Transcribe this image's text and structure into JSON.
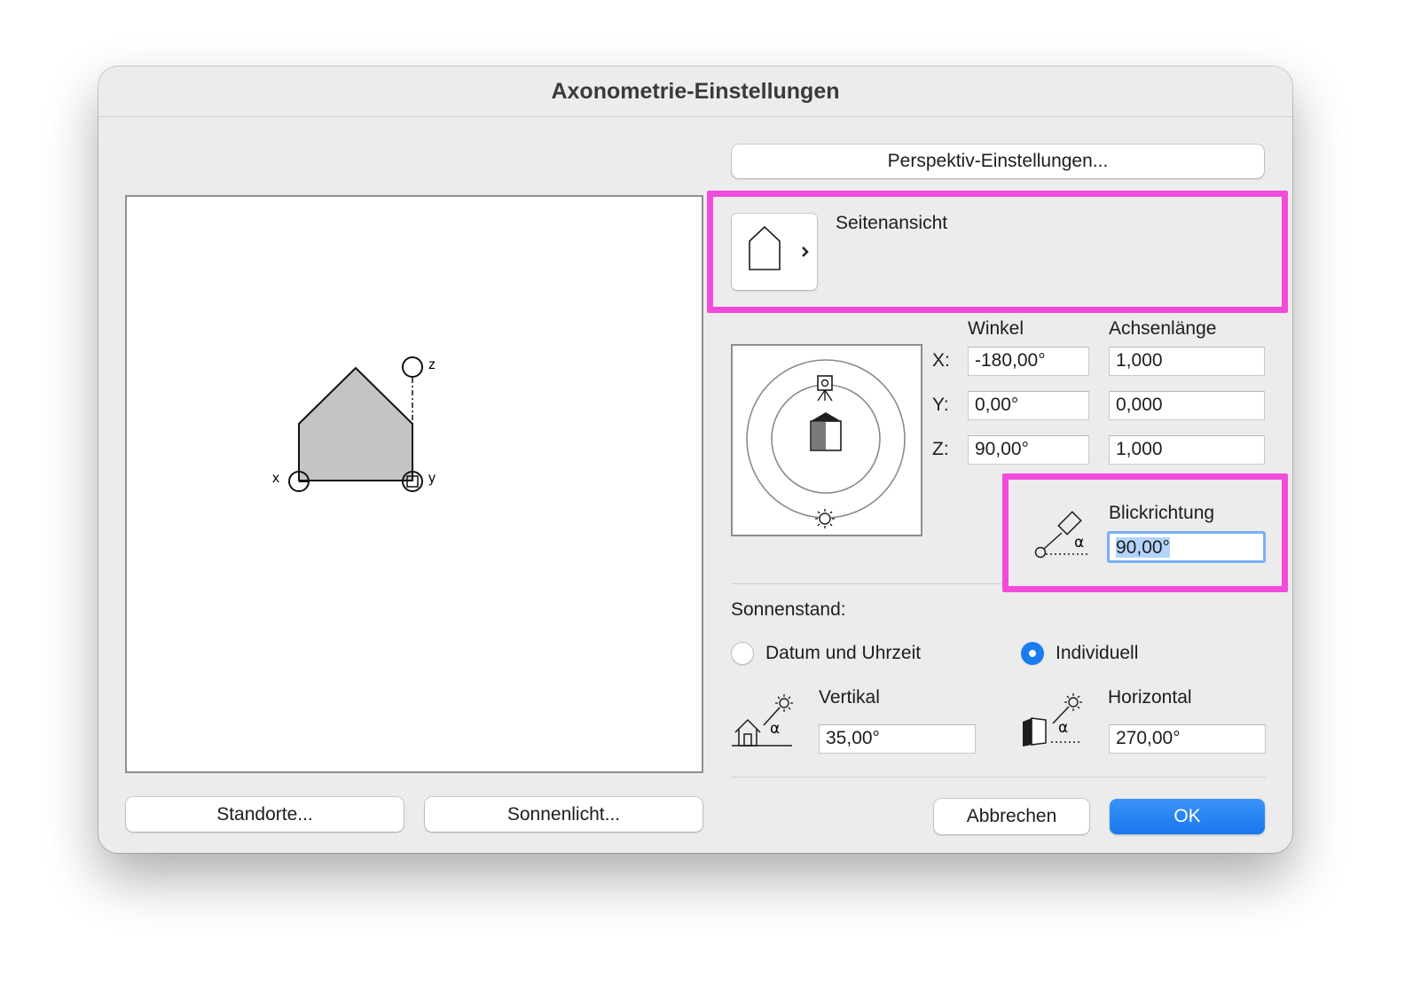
{
  "window": {
    "title": "Axonometrie-Einstellungen"
  },
  "buttons": {
    "perspective": "Perspektiv-Einstellungen...",
    "locations": "Standorte...",
    "sunlight": "Sonnenlicht...",
    "cancel": "Abbrechen",
    "ok": "OK"
  },
  "preview": {
    "axis_x": "x",
    "axis_y": "y",
    "axis_z": "z"
  },
  "view": {
    "name": "Seitenansicht"
  },
  "table": {
    "col_angle": "Winkel",
    "col_axis_length": "Achsenlänge",
    "rows": [
      {
        "label": "X:",
        "angle": "-180,00°",
        "length": "1,000"
      },
      {
        "label": "Y:",
        "angle": "0,00°",
        "length": "0,000"
      },
      {
        "label": "Z:",
        "angle": "90,00°",
        "length": "1,000"
      }
    ]
  },
  "view_direction": {
    "label": "Blickrichtung",
    "value": "90,00°"
  },
  "sun": {
    "heading": "Sonnenstand:",
    "option_date": "Datum und Uhrzeit",
    "option_custom": "Individuell",
    "selected": "Individuell",
    "vertical_label": "Vertikal",
    "vertical_value": "35,00°",
    "horizontal_label": "Horizontal",
    "horizontal_value": "270,00°"
  },
  "colors": {
    "accent": "#1a7cf0",
    "highlight": "#f14bdc",
    "house_fill": "#c4c4c4"
  },
  "icons": {
    "view_type": "house-outline-icon",
    "camera_orbit": "camera-orbit-icon",
    "view_direction": "camera-angle-icon",
    "sun_vertical": "house-sun-angle-icon",
    "sun_horizontal": "box-sun-angle-icon"
  }
}
